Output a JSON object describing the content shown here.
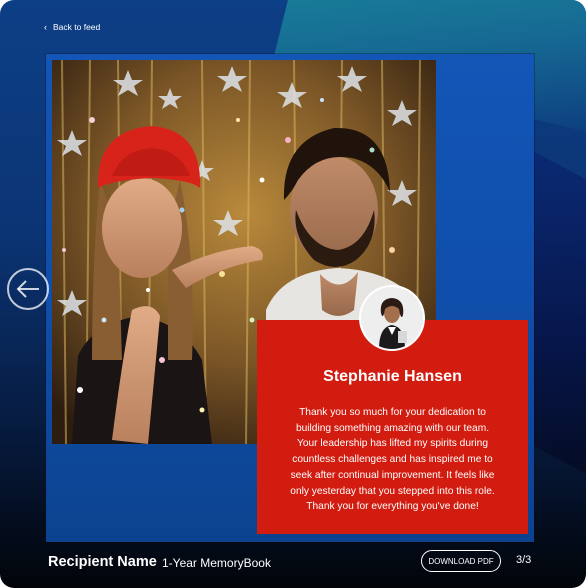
{
  "nav": {
    "back_label": "Back to feed",
    "back_icon": "chevron-left-icon"
  },
  "slide": {
    "photo_description_icon": "celebration-photo",
    "card": {
      "name": "Stephanie Hansen",
      "message": "Thank you so much for your dedication to building something amazing with our team. Your leadership has lifted my spirits during countless challenges and has inspired me to seek after continual improvement. It feels like only yesterday that you stepped into this role. Thank you for everything you've done!",
      "background_color": "#d21c10"
    },
    "prev_icon": "arrow-left-icon"
  },
  "footer": {
    "recipient": "Recipient Name",
    "book_title": "1-Year MemoryBook",
    "download_label": "DOWNLOAD PDF",
    "pager": "3/3"
  },
  "colors": {
    "accent_teal": "#1c9aa0",
    "background_blue": "#0d3f86",
    "slide_blue": "#1356b7"
  }
}
